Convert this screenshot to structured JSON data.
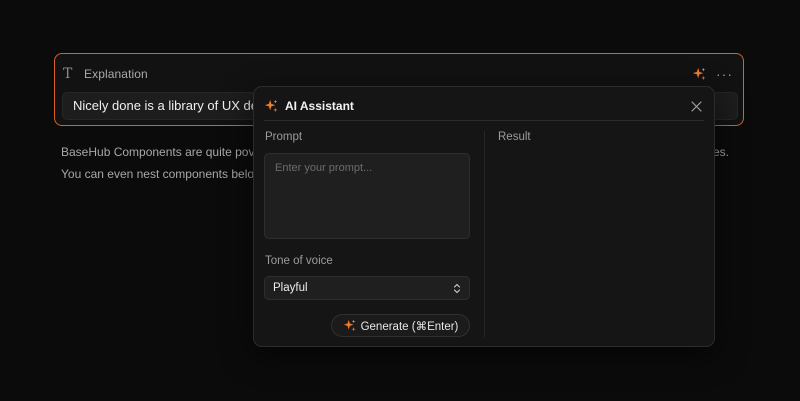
{
  "field": {
    "label": "Explanation",
    "value": "Nicely done is a library of UX desi"
  },
  "body": {
    "line1": "BaseHub Components are quite pov",
    "line1_tail": "es.",
    "line2": "You can even nest components belo"
  },
  "assistant": {
    "title": "AI Assistant",
    "prompt_label": "Prompt",
    "prompt_placeholder": "Enter your prompt...",
    "result_label": "Result",
    "tone_label": "Tone of voice",
    "tone_value": "Playful",
    "generate_label": "Generate (⌘Enter)"
  },
  "icons": {
    "type": "text-type-icon",
    "spark": "sparkles-icon",
    "more": "more-horizontal-icon",
    "close": "close-icon",
    "select": "chevron-up-down-icon"
  },
  "colors": {
    "accent": "#d9622b",
    "spark": "#f07a2e",
    "background": "#0b0b0b"
  }
}
